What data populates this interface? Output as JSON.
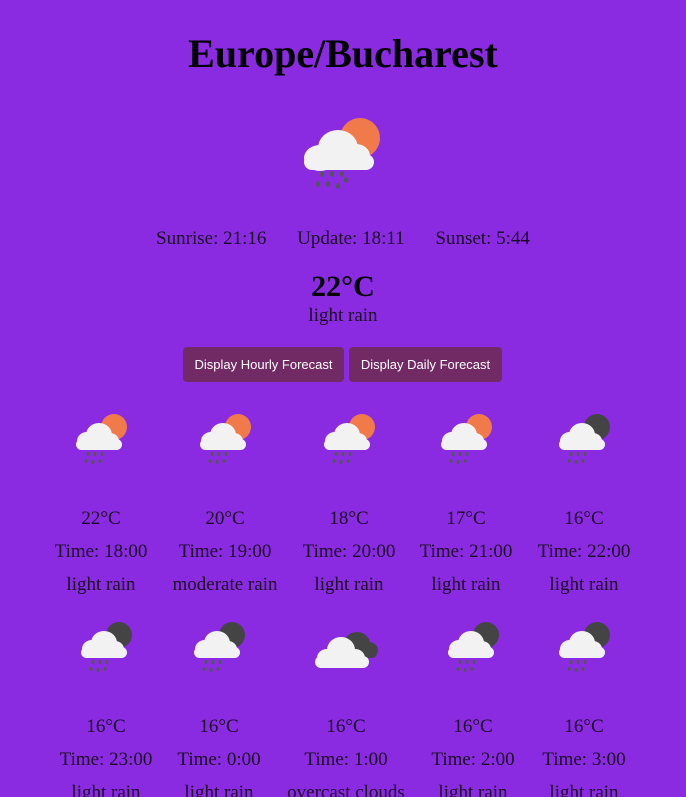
{
  "location": {
    "city": "Europe/Bucharest"
  },
  "current": {
    "icon": "rain-sun-icon",
    "sunrise_text": "Sunrise: 21:16",
    "update_text": "Update: 18:11",
    "sunset_text": "Sunset: 5:44",
    "temperature": "22°C",
    "description": "light rain"
  },
  "buttons": {
    "hourly_label": "Display Hourly Forecast",
    "daily_label": "Display Daily Forecast"
  },
  "colors": {
    "background": "#8a2be2",
    "button": "#722a65",
    "sun": "#f07a4a",
    "moon": "#444444",
    "cloud": "#f2f2f2"
  },
  "forecast": [
    {
      "icon": "rain-sun-icon",
      "temp": "22°C",
      "time": "Time: 18:00",
      "desc": "light rain"
    },
    {
      "icon": "rain-sun-icon",
      "temp": "20°C",
      "time": "Time: 19:00",
      "desc": "moderate rain"
    },
    {
      "icon": "rain-sun-icon",
      "temp": "18°C",
      "time": "Time: 20:00",
      "desc": "light rain"
    },
    {
      "icon": "rain-sun-icon",
      "temp": "17°C",
      "time": "Time: 21:00",
      "desc": "light rain"
    },
    {
      "icon": "rain-moon-icon",
      "temp": "16°C",
      "time": "Time: 22:00",
      "desc": "light rain"
    },
    {
      "icon": "rain-moon-icon",
      "temp": "16°C",
      "time": "Time: 23:00",
      "desc": "light rain"
    },
    {
      "icon": "rain-moon-icon",
      "temp": "16°C",
      "time": "Time: 0:00",
      "desc": "light rain"
    },
    {
      "icon": "overcast-clouds-icon",
      "temp": "16°C",
      "time": "Time: 1:00",
      "desc": "overcast clouds"
    },
    {
      "icon": "rain-moon-icon",
      "temp": "16°C",
      "time": "Time: 2:00",
      "desc": "light rain"
    },
    {
      "icon": "rain-moon-icon",
      "temp": "16°C",
      "time": "Time: 3:00",
      "desc": "light rain"
    }
  ]
}
